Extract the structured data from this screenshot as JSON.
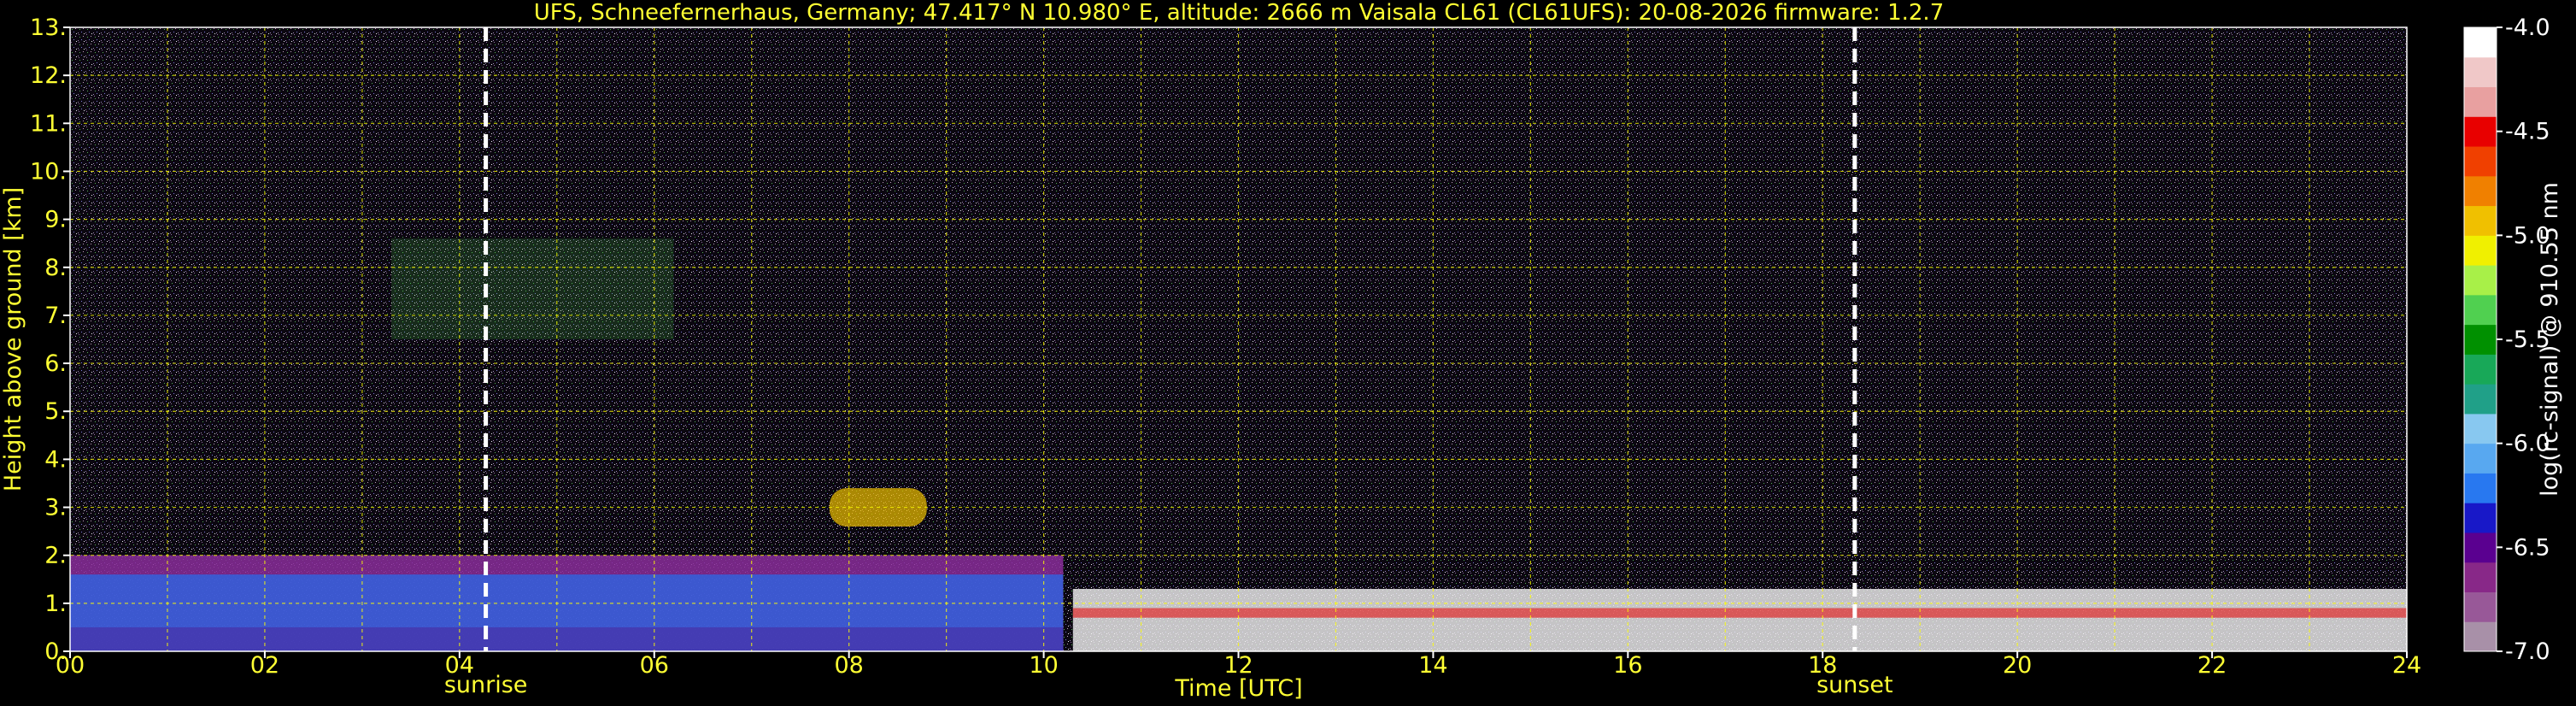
{
  "chart_data": {
    "type": "heatmap",
    "title": "UFS, Schneefernerhaus, Germany; 47.417° N 10.980° E, altitude: 2666 m    Vaisala CL61 (CL61UFS): 20-08-2026    firmware: 1.2.7",
    "xlabel": "Time [UTC]",
    "ylabel": "Height above ground [km]",
    "xlim": [
      0,
      24
    ],
    "ylim": [
      0,
      13
    ],
    "x_ticks": [
      "00",
      "02",
      "04",
      "06",
      "08",
      "10",
      "12",
      "14",
      "16",
      "18",
      "20",
      "22",
      "24"
    ],
    "y_ticks": [
      "0.",
      "1.",
      "2.",
      "3.",
      "4.",
      "5.",
      "6.",
      "7.",
      "8.",
      "9.",
      "10.",
      "11.",
      "12.",
      "13."
    ],
    "grid": true,
    "grid_color": "#ffff00",
    "background": "#000000",
    "text_color": "#ffff33",
    "events": [
      {
        "label": "sunrise",
        "time": 4.27
      },
      {
        "label": "sunset",
        "time": 18.33
      }
    ],
    "colorbar": {
      "label": "log(rc-signal) @ 910.55 nm",
      "range": [
        -7.0,
        -4.0
      ],
      "ticks": [
        "-4.0",
        "-4.5",
        "-5.0",
        "-5.5",
        "-6.0",
        "-6.5",
        "-7.0"
      ],
      "colors": [
        "#a890a8",
        "#985898",
        "#882888",
        "#5a0090",
        "#1818c8",
        "#2878f0",
        "#58a8f0",
        "#88c8f0",
        "#20a088",
        "#18a858",
        "#009000",
        "#50d050",
        "#a8f048",
        "#f0f000",
        "#f0c000",
        "#f08000",
        "#f04000",
        "#e80000",
        "#e8a0a0",
        "#f0c8c8",
        "#ffffff"
      ]
    },
    "features": [
      {
        "type": "boundary_layer",
        "x_start": 0,
        "x_end": 10.2,
        "y_top": 2.0
      },
      {
        "type": "cloud_layer",
        "x_start": 10.3,
        "x_end": 24,
        "y_top": 1.3
      },
      {
        "type": "cirrus",
        "x_start": 3.3,
        "x_end": 6.2,
        "y_bottom": 6.5,
        "y_top": 8.6
      },
      {
        "type": "aerosol_layer",
        "x_start": 7.8,
        "x_end": 8.8,
        "y_bottom": 2.6,
        "y_top": 3.4
      }
    ]
  }
}
